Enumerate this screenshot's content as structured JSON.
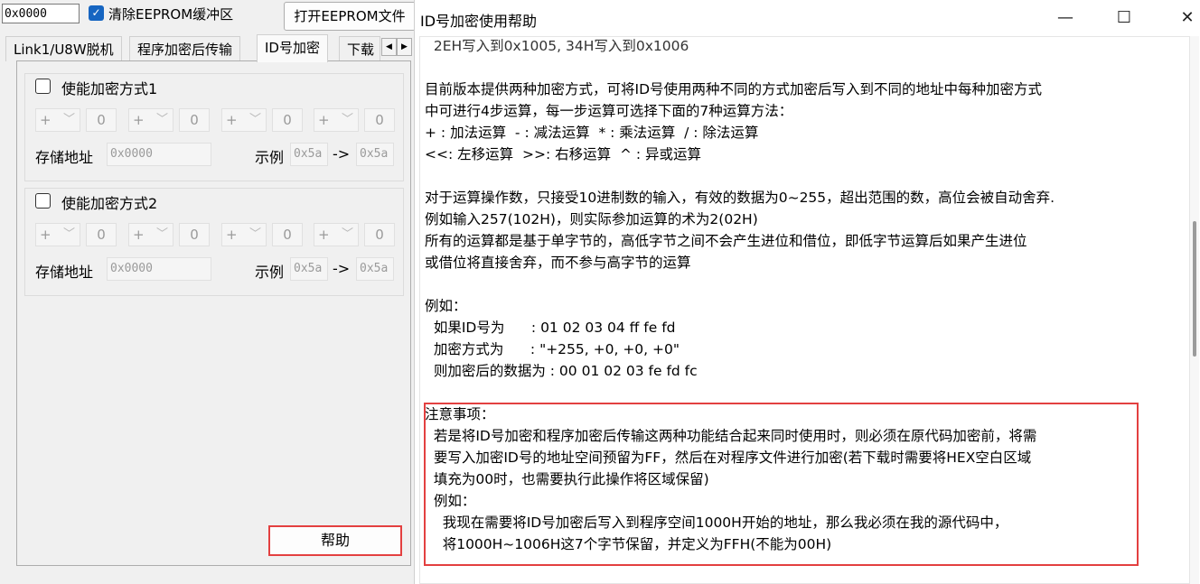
{
  "toolbar": {
    "address_value": "0x0000",
    "clear_eeprom_label": "清除EEPROM缓冲区",
    "open_eeprom_label": "打开EEPROM文件"
  },
  "tabs": [
    {
      "label": "Link1/U8W脱机"
    },
    {
      "label": "程序加密后传输"
    },
    {
      "label": "ID号加密"
    },
    {
      "label": "下载"
    }
  ],
  "tab_scroll": {
    "left": "◀",
    "right": "▶"
  },
  "groups": [
    {
      "title": "使能加密方式1",
      "ops": [
        {
          "op": "+",
          "value": "0"
        },
        {
          "op": "+",
          "value": "0"
        },
        {
          "op": "+",
          "value": "0"
        },
        {
          "op": "+",
          "value": "0"
        }
      ],
      "addr_label": "存储地址",
      "addr_value": "0x0000",
      "example_label": "示例",
      "example_in": "0x5a",
      "arrow": "->",
      "example_out": "0x5a"
    },
    {
      "title": "使能加密方式2",
      "ops": [
        {
          "op": "+",
          "value": "0"
        },
        {
          "op": "+",
          "value": "0"
        },
        {
          "op": "+",
          "value": "0"
        },
        {
          "op": "+",
          "value": "0"
        }
      ],
      "addr_label": "存储地址",
      "addr_value": "0x0000",
      "example_label": "示例",
      "example_in": "0x5a",
      "arrow": "->",
      "example_out": "0x5a"
    }
  ],
  "help_button_label": "帮助",
  "dialog": {
    "title": "ID号加密使用帮助",
    "minimize": "—",
    "maximize": "☐",
    "close": "✕",
    "lines": [
      "  2EH写入到0x1005, 34H写入到0x1006",
      "",
      "目前版本提供两种加密方式，可将ID号使用两种不同的方式加密后写入到不同的地址中每种加密方式",
      "中可进行4步运算，每一步运算可选择下面的7种运算方法：",
      "+ : 加法运算  - : 减法运算  * : 乘法运算  / : 除法运算",
      "<<: 左移运算  >>: 右移运算  ^ : 异或运算",
      "",
      "对于运算操作数，只接受10进制数的输入，有效的数据为0~255，超出范围的数，高位会被自动舍弃.",
      "例如输入257(102H)，则实际参加运算的术为2(02H)",
      "所有的运算都是基于单字节的，高低字节之间不会产生进位和借位，即低字节运算后如果产生进位",
      "或借位将直接舍弃，而不参与高字节的运算",
      "",
      "例如：",
      "  如果ID号为      : 01 02 03 04 ff fe fd",
      "  加密方式为      : \"+255, +0, +0, +0\"",
      "  则加密后的数据为 : 00 01 02 03 fe fd fc",
      "",
      "注意事项：",
      "  若是将ID号加密和程序加密后传输这两种功能结合起来同时使用时，则必须在原代码加密前，将需",
      "  要写入加密ID号的地址空间预留为FF，然后在对程序文件进行加密(若下载时需要将HEX空白区域",
      "  填充为00时，也需要执行此操作将区域保留)",
      "  例如：",
      "    我现在需要将ID号加密后写入到程序空间1000H开始的地址，那么我必须在我的源代码中，",
      "    将1000H~1006H这7个字节保留，并定义为FFH(不能为00H)"
    ]
  },
  "colors": {
    "accent_blue": "#1665c1",
    "highlight_red": "#e34040"
  }
}
